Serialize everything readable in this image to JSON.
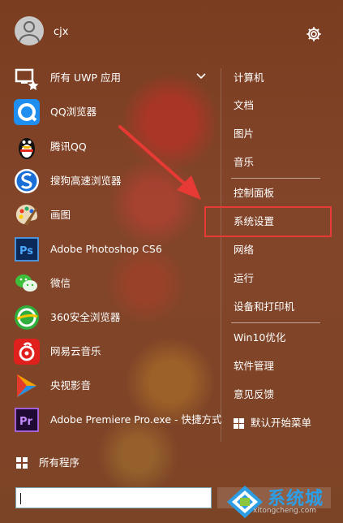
{
  "user": {
    "name": "cjx"
  },
  "left_list": {
    "group_label": "所有 UWP 应用",
    "apps": [
      "QQ浏览器",
      "腾讯QQ",
      "搜狗高速浏览器",
      "画图",
      "Adobe Photoshop CS6",
      "微信",
      "360安全浏览器",
      "网易云音乐",
      "央视影音",
      "Adobe Premiere Pro.exe - 快捷方式"
    ],
    "all_programs": "所有程序"
  },
  "right_list": {
    "items": [
      "计算机",
      "文档",
      "图片",
      "音乐",
      "控制面板",
      "系统设置",
      "网络",
      "运行",
      "设备和打印机",
      "Win10优化",
      "软件管理",
      "意见反馈",
      "默认开始菜单"
    ]
  },
  "search": {
    "value": ""
  },
  "watermark": {
    "text": "系统城",
    "sub": "xitongcheng.com"
  },
  "colors": {
    "highlight": "#e83a34",
    "arrow": "#e83a34"
  }
}
